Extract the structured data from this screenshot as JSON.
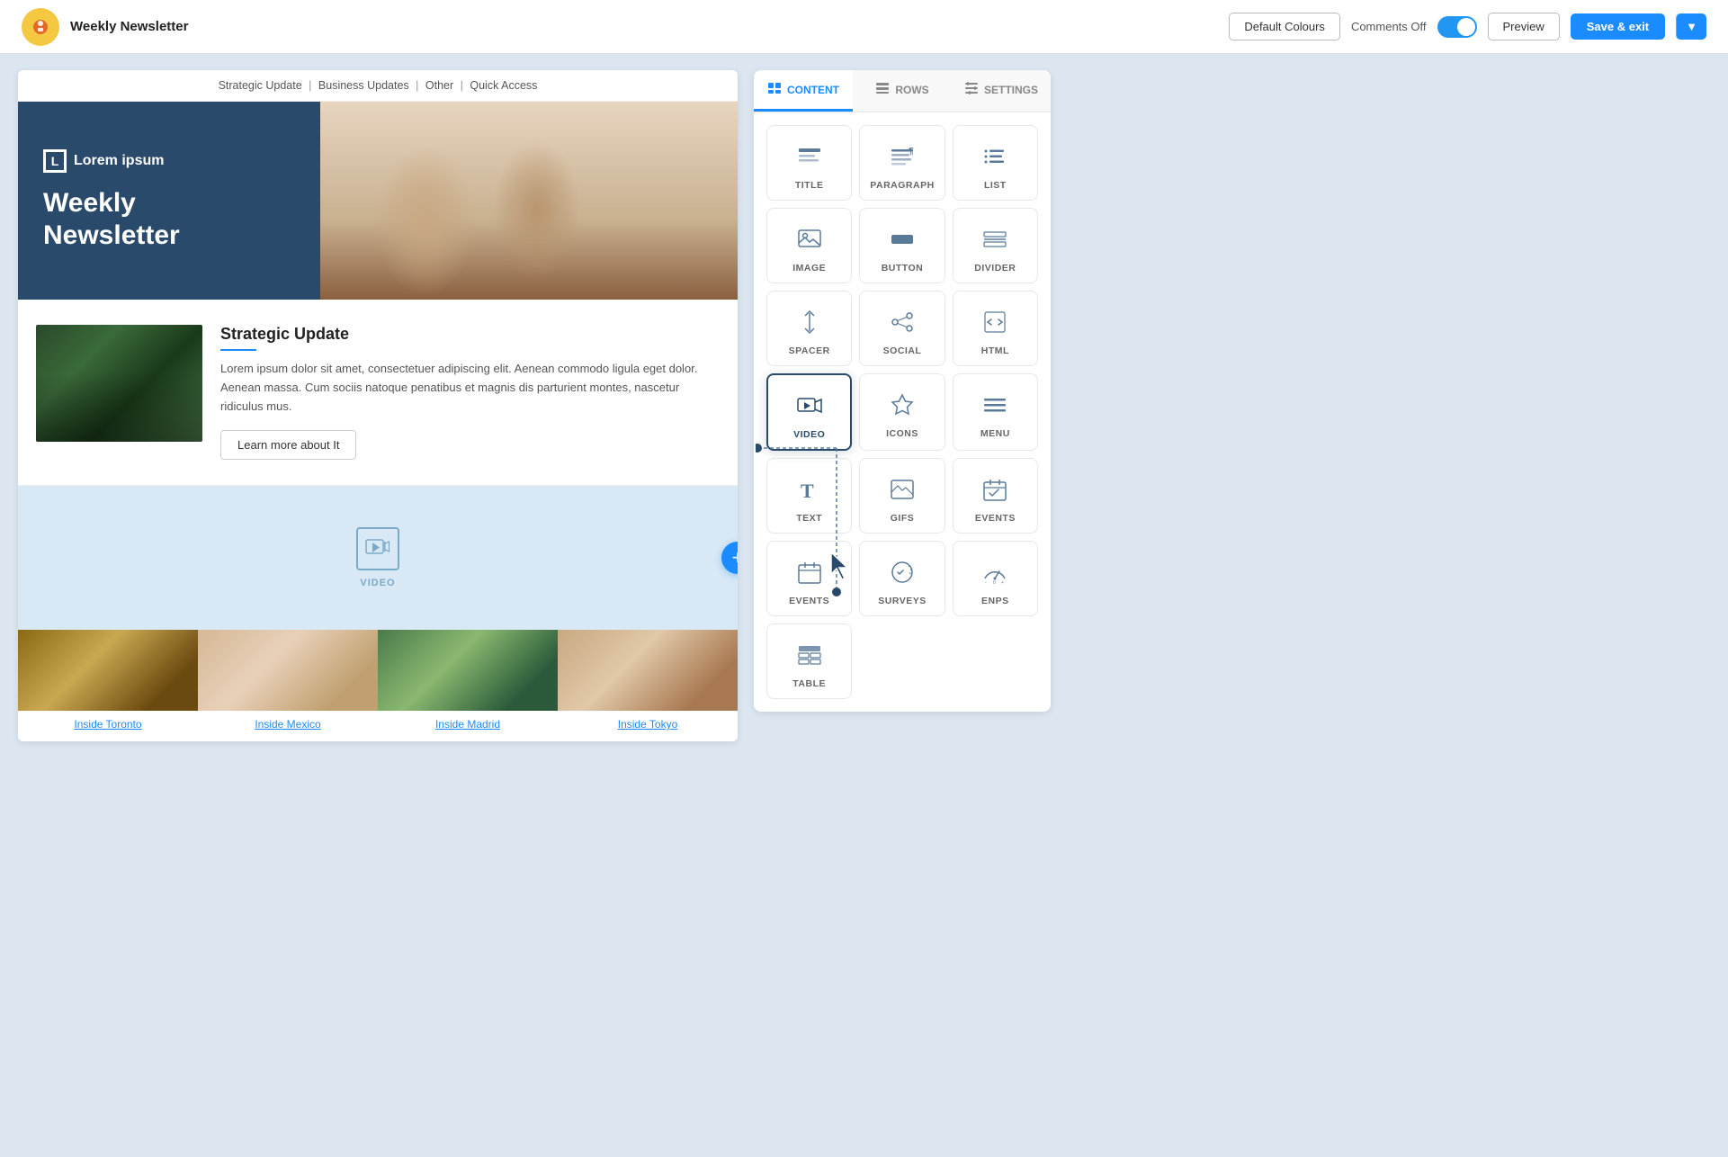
{
  "topbar": {
    "logo_alt": "App Logo",
    "title": "Weekly Newsletter",
    "default_colours_btn": "Default Colours",
    "comments_label": "Comments Off",
    "preview_btn": "Preview",
    "save_exit_btn": "Save & exit",
    "caret_label": "▾"
  },
  "email_nav": {
    "items": [
      "Strategic Update",
      "Business Updates",
      "Other",
      "Quick Access"
    ],
    "separators": "|"
  },
  "hero": {
    "logo_mark": "L",
    "logo_text": "Lorem ipsum",
    "title_line1": "Weekly",
    "title_line2": "Newsletter"
  },
  "article": {
    "title": "Strategic Update",
    "body": "Lorem ipsum dolor sit amet, consectetuer adipiscing elit. Aenean commodo ligula eget dolor. Aenean massa. Cum sociis natoque penatibus et magnis dis parturient montes, nascetur ridiculus mus.",
    "button": "Learn more about It"
  },
  "video_block": {
    "label": "VIDEO"
  },
  "grid": {
    "items": [
      {
        "caption": "Inside Toronto"
      },
      {
        "caption": "Inside Mexico"
      },
      {
        "caption": "Inside Madrid"
      },
      {
        "caption": "Inside Tokyo"
      }
    ]
  },
  "panel": {
    "tabs": [
      {
        "id": "content",
        "label": "CONTENT",
        "active": true
      },
      {
        "id": "rows",
        "label": "ROWS",
        "active": false
      },
      {
        "id": "settings",
        "label": "SETTINGS",
        "active": false
      }
    ],
    "content_items": [
      {
        "id": "title",
        "label": "TITLE"
      },
      {
        "id": "paragraph",
        "label": "PARAGRAPH"
      },
      {
        "id": "list",
        "label": "LIST"
      },
      {
        "id": "image",
        "label": "IMAGE"
      },
      {
        "id": "button",
        "label": "BUTTON"
      },
      {
        "id": "divider",
        "label": "DIVIDER"
      },
      {
        "id": "spacer",
        "label": "SPACER"
      },
      {
        "id": "social",
        "label": "SOCIAL"
      },
      {
        "id": "html",
        "label": "HTML"
      },
      {
        "id": "video",
        "label": "VIDEO",
        "selected": true
      },
      {
        "id": "icons",
        "label": "ICONS"
      },
      {
        "id": "menu",
        "label": "MENU"
      },
      {
        "id": "text",
        "label": "TEXT"
      },
      {
        "id": "gifs",
        "label": "GIFS"
      },
      {
        "id": "events",
        "label": "EVENTS"
      },
      {
        "id": "events2",
        "label": "EVENTS"
      },
      {
        "id": "surveys",
        "label": "SURVEYS"
      },
      {
        "id": "enps",
        "label": "ENPS"
      },
      {
        "id": "table",
        "label": "TABLE"
      }
    ]
  }
}
